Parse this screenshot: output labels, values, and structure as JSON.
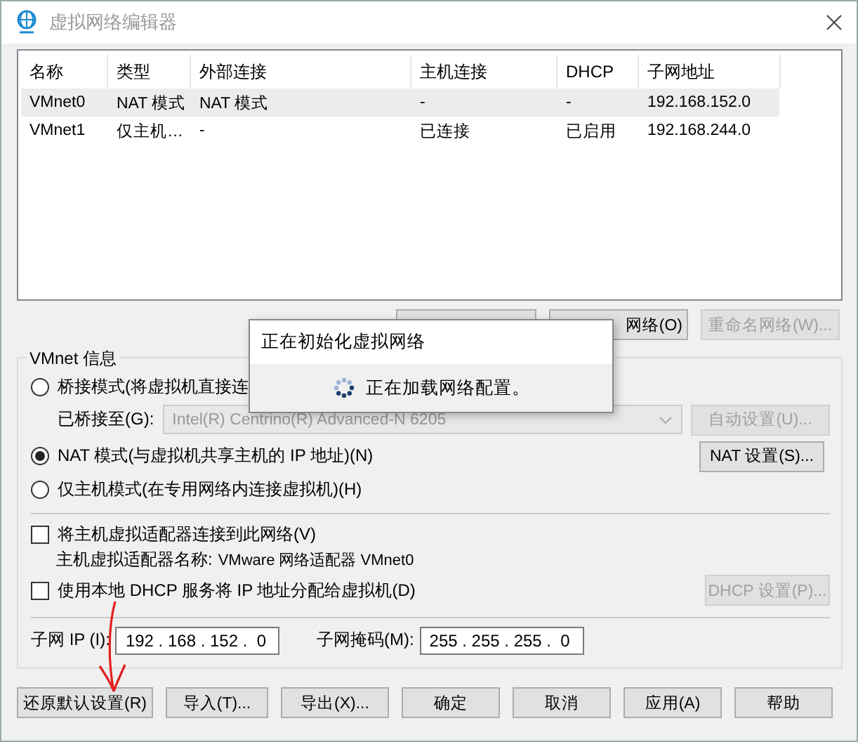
{
  "window": {
    "title": "虚拟网络编辑器"
  },
  "network_table": {
    "columns": [
      "名称",
      "类型",
      "外部连接",
      "主机连接",
      "DHCP",
      "子网地址"
    ],
    "rows": [
      {
        "cells": [
          "VMnet0",
          "NAT 模式",
          "NAT 模式",
          "-",
          "-",
          "192.168.152.0"
        ],
        "selected": true
      },
      {
        "cells": [
          "VMnet1",
          "仅主机…",
          "-",
          "已连接",
          "已启用",
          "192.168.244.0"
        ],
        "selected": false
      }
    ]
  },
  "table_buttons": [
    {
      "kind": "covered",
      "disabled": false
    },
    {
      "kind": "labeled",
      "label": "网络(O)",
      "disabled": false
    },
    {
      "kind": "labeled",
      "label": "重命名网络(W)...",
      "disabled": true
    }
  ],
  "vmnet_info": {
    "title": "VMnet 信息",
    "modes": [
      {
        "label": "桥接模式(将虚拟机直接连",
        "selected": false
      },
      {
        "label": "NAT 模式(与虚拟机共享主机的 IP 地址)(N)",
        "selected": true
      },
      {
        "label": "仅主机模式(在专用网络内连接虚拟机)(H)",
        "selected": false
      }
    ],
    "bridged_to": {
      "label": "已桥接至(G):",
      "value": "Intel(R) Centrino(R) Advanced-N 6205",
      "disabled": true
    },
    "auto_button": {
      "label": "自动设置(U)...",
      "disabled": true
    },
    "nat_button": {
      "label": "NAT 设置(S)...",
      "disabled": false
    },
    "host_adapter": {
      "label": "将主机虚拟适配器连接到此网络(V)",
      "checked": false
    },
    "adapter_name": {
      "label": "主机虚拟适配器名称:",
      "value": "VMware 网络适配器 VMnet0"
    },
    "dhcp": {
      "label": "使用本地 DHCP 服务将 IP 地址分配给虚拟机(D)",
      "checked": false
    },
    "dhcp_button": {
      "label": "DHCP 设置(P)...",
      "disabled": true
    },
    "subnet_ip": {
      "label": "子网 IP (I):",
      "value": "192 . 168 . 152 .  0"
    },
    "subnet_mask": {
      "label": "子网掩码(M):",
      "value": "255 . 255 . 255 .  0"
    }
  },
  "footer_buttons": [
    {
      "label": "还原默认设置(R)",
      "disabled": false
    },
    {
      "label": "导入(T)...",
      "disabled": false
    },
    {
      "label": "导出(X)...",
      "disabled": false
    },
    {
      "label": "确定",
      "disabled": false
    },
    {
      "label": "取消",
      "disabled": false
    },
    {
      "label": "应用(A)",
      "disabled": false
    },
    {
      "label": "帮助",
      "disabled": false
    }
  ],
  "progress_dialog": {
    "title": "正在初始化虚拟网络",
    "message": "正在加载网络配置。"
  }
}
